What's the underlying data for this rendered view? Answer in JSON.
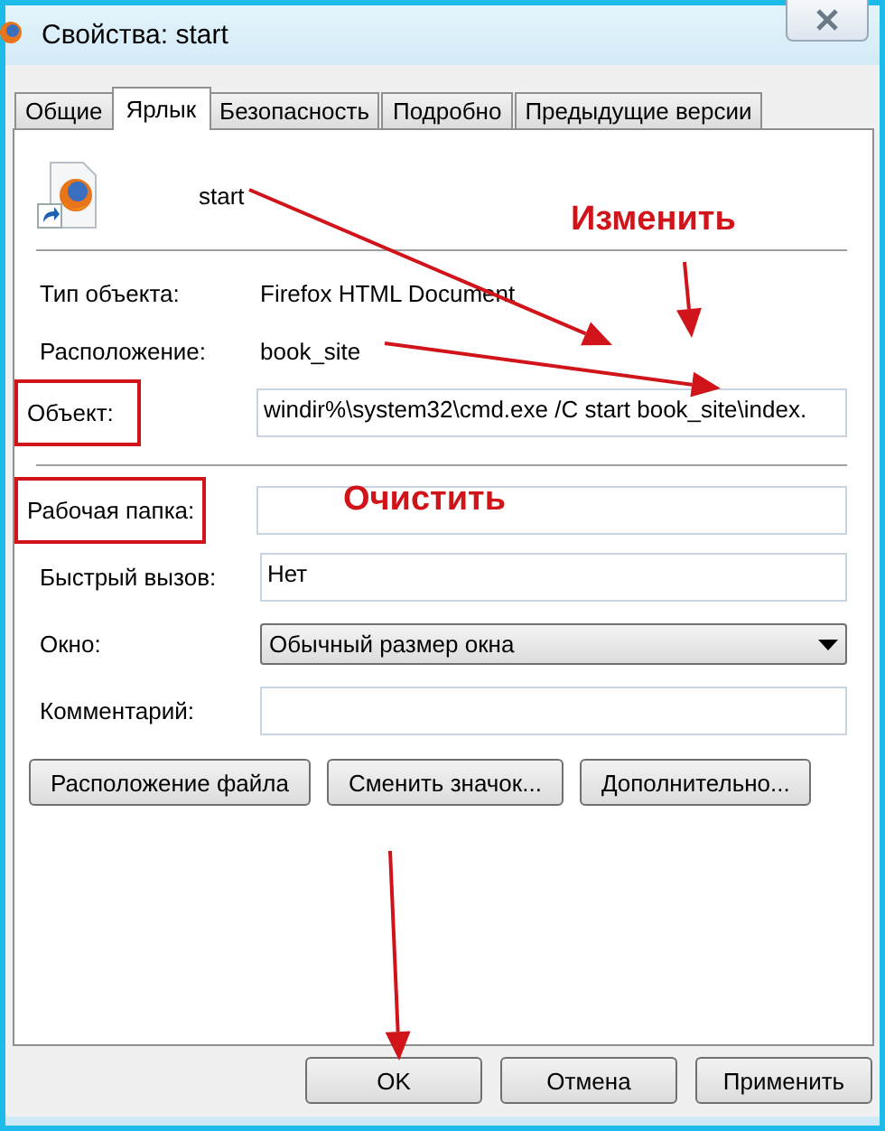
{
  "window": {
    "title": "Свойства: start"
  },
  "tabs": [
    {
      "label": "Общие",
      "selected": false
    },
    {
      "label": "Ярлык",
      "selected": true
    },
    {
      "label": "Безопасность",
      "selected": false
    },
    {
      "label": "Подробно",
      "selected": false
    },
    {
      "label": "Предыдущие версии",
      "selected": false
    }
  ],
  "shortcut": {
    "name": "start"
  },
  "fields_top": [
    {
      "kind": "text",
      "label": "Тип объекта:",
      "value": "Firefox HTML Document",
      "highlighted": false
    },
    {
      "kind": "text",
      "label": "Расположение:",
      "value": "book_site",
      "highlighted": false
    },
    {
      "kind": "input",
      "label": "Объект:",
      "value": "windir%\\system32\\cmd.exe /C start  book_site\\index.",
      "highlighted": true
    }
  ],
  "fields_bottom": [
    {
      "kind": "input",
      "label": "Рабочая папка:",
      "highlighted": true
    },
    {
      "kind": "input",
      "label": "Быстрый вызов:",
      "value": "Нет",
      "highlighted": false
    },
    {
      "kind": "select",
      "label": "Окно:",
      "value": "Обычный размер окна",
      "highlighted": false
    },
    {
      "kind": "input",
      "label": "Комментарий:",
      "highlighted": false
    }
  ],
  "actions": [
    "Расположение файла",
    "Сменить значок...",
    "Дополнительно..."
  ],
  "buttons": [
    "OK",
    "Отмена",
    "Применить"
  ],
  "annotations": [
    {
      "text": "Изменить"
    },
    {
      "text": "Очистить"
    }
  ]
}
